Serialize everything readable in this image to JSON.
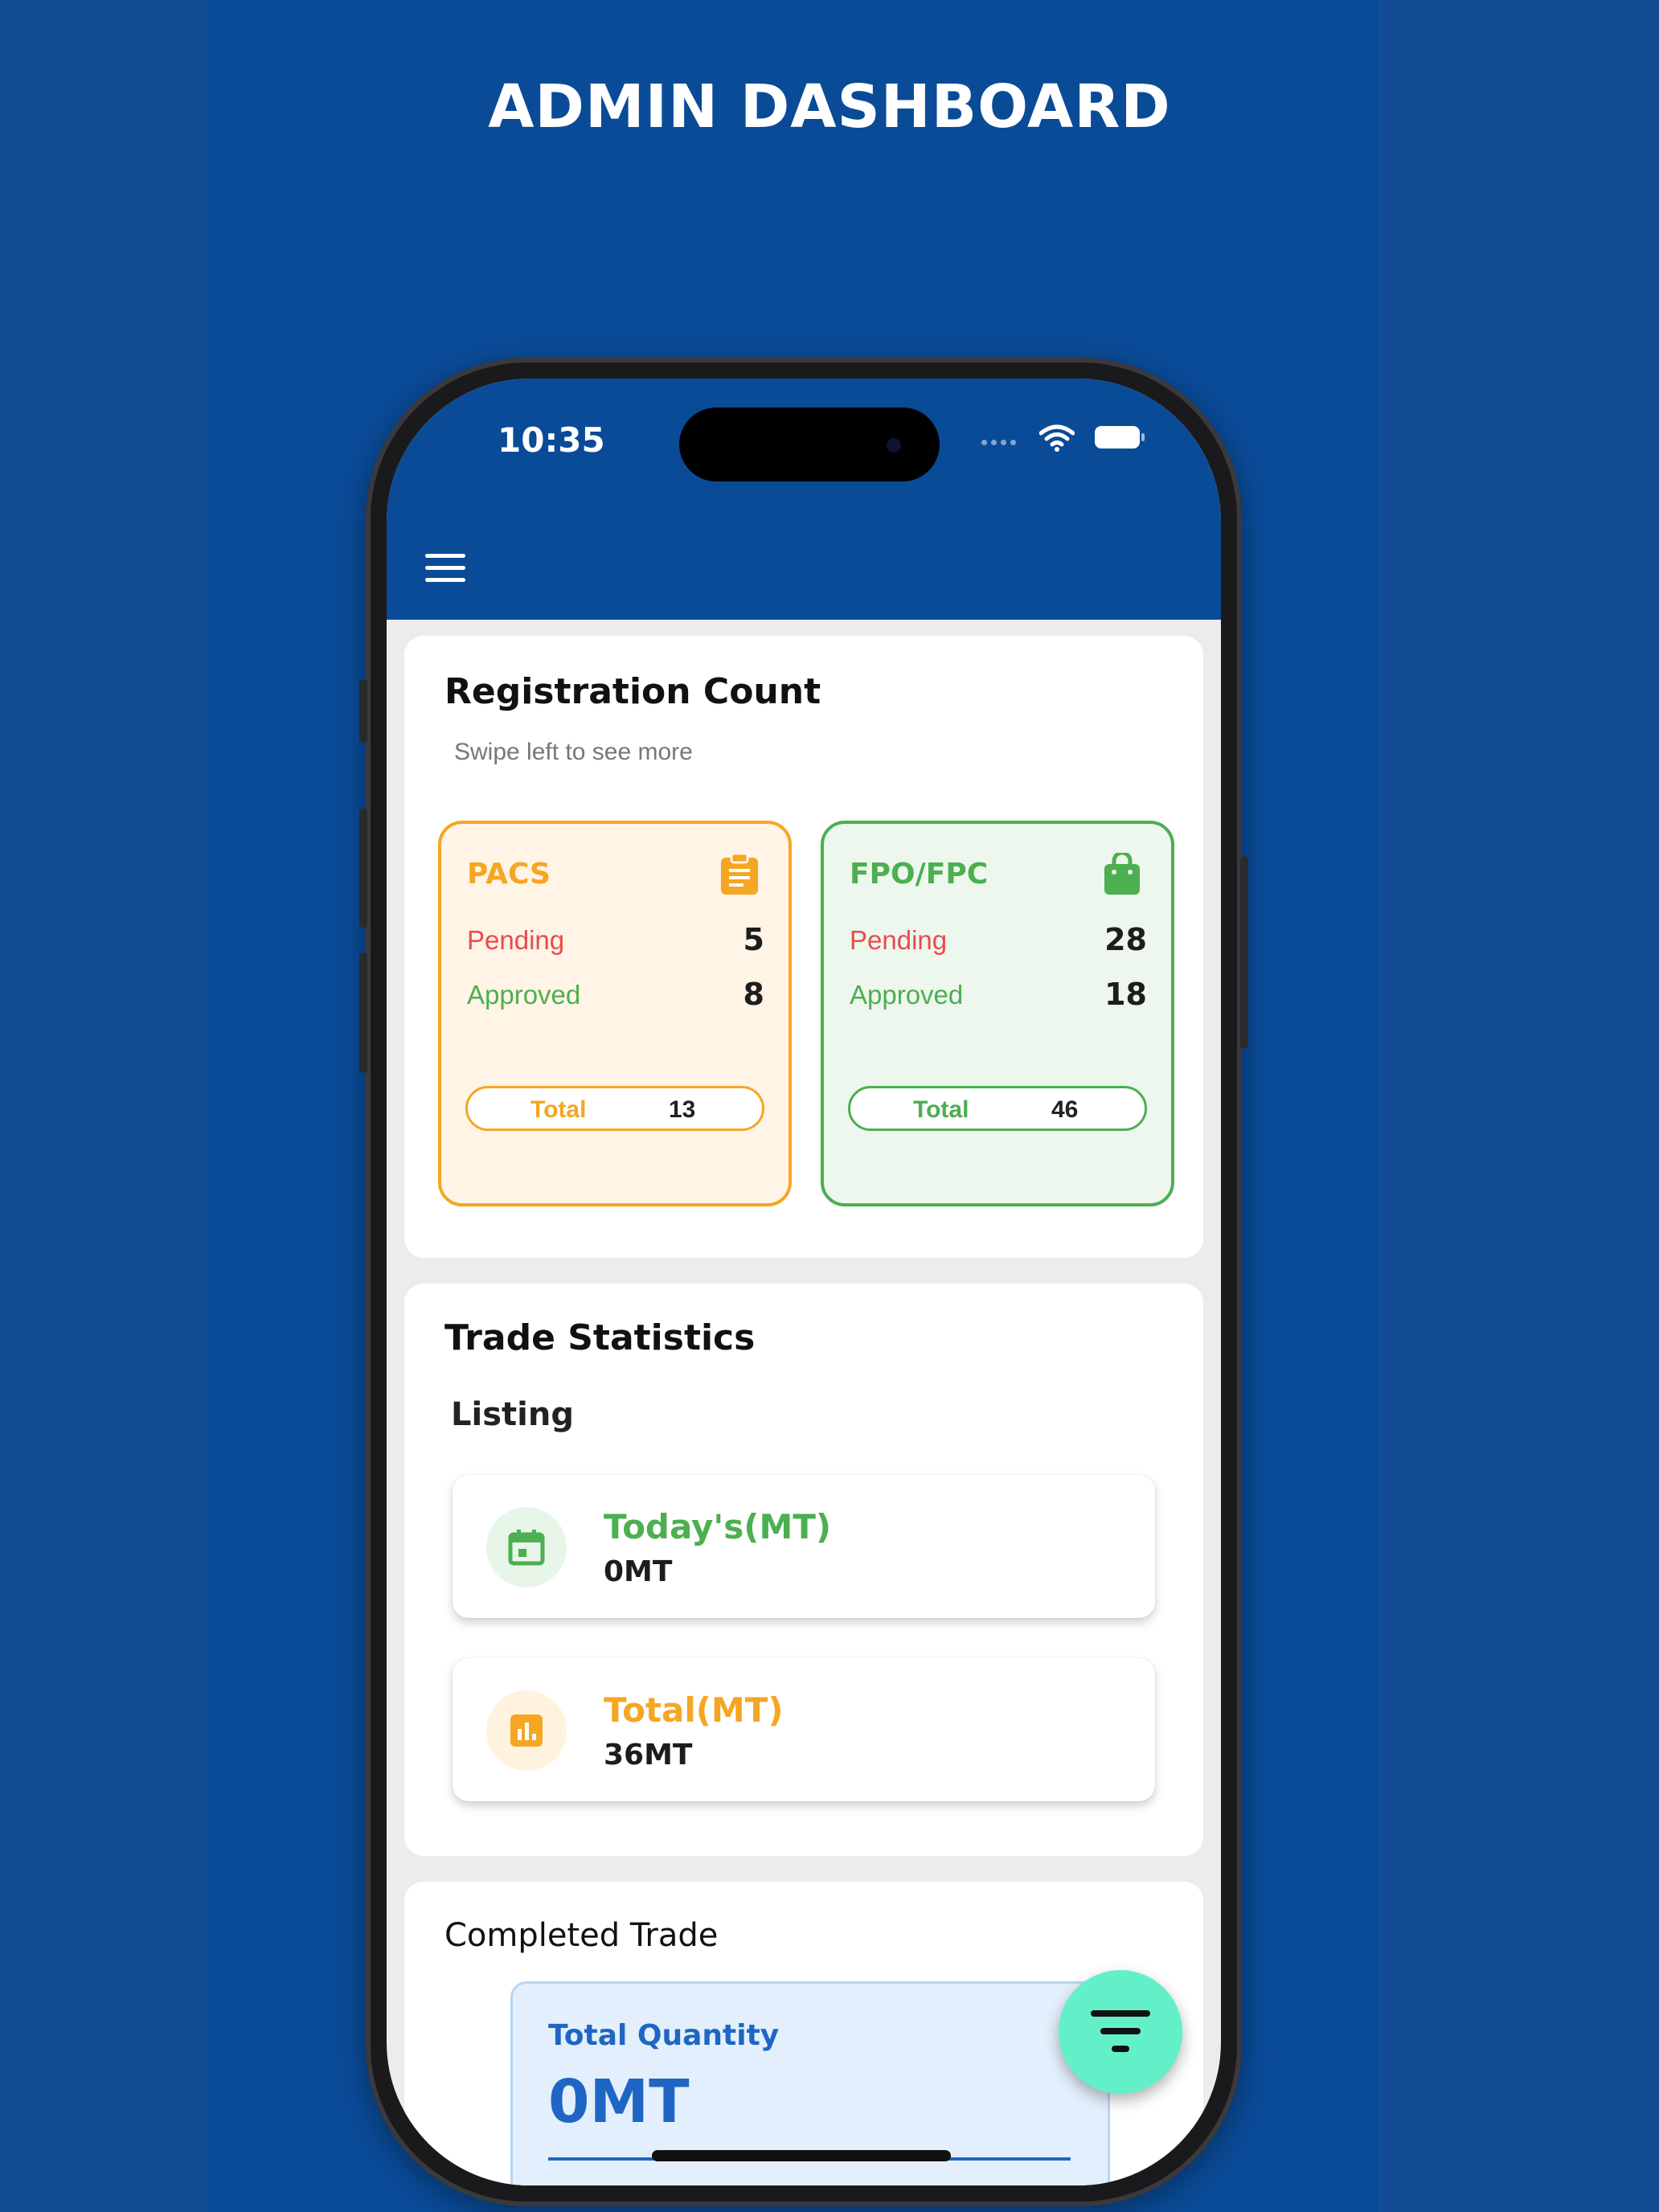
{
  "headline": "ADMIN DASHBOARD",
  "status_bar": {
    "time": "10:35"
  },
  "registration": {
    "title": "Registration Count",
    "hint": "Swipe left to see more",
    "pacs": {
      "name": "PACS",
      "pending_label": "Pending",
      "pending": "5",
      "approved_label": "Approved",
      "approved": "8",
      "total_label": "Total",
      "total": "13",
      "icon": "clipboard-icon",
      "color": "#f5a623"
    },
    "fpo": {
      "name": "FPO/FPC",
      "pending_label": "Pending",
      "pending": "28",
      "approved_label": "Approved",
      "approved": "18",
      "total_label": "Total",
      "total": "46",
      "icon": "shopping-bag-icon",
      "color": "#4caf50"
    }
  },
  "trade": {
    "title": "Trade Statistics",
    "listing_label": "Listing",
    "today": {
      "title": "Today's(MT)",
      "value": "0MT",
      "icon": "calendar-icon",
      "color": "#4caf50"
    },
    "total": {
      "title": "Total(MT)",
      "value": "36MT",
      "icon": "bar-chart-icon",
      "color": "#f5a623"
    }
  },
  "completed": {
    "title": "Completed Trade",
    "quantity_label": "Total Quantity",
    "quantity_value": "0MT"
  },
  "fab": {
    "icon": "filter-icon",
    "color": "#63f0c8"
  },
  "colors": {
    "brand": "#0a4b98",
    "pending": "#e84c4c",
    "approved": "#4caf50",
    "accent_blue": "#1f66c4"
  }
}
